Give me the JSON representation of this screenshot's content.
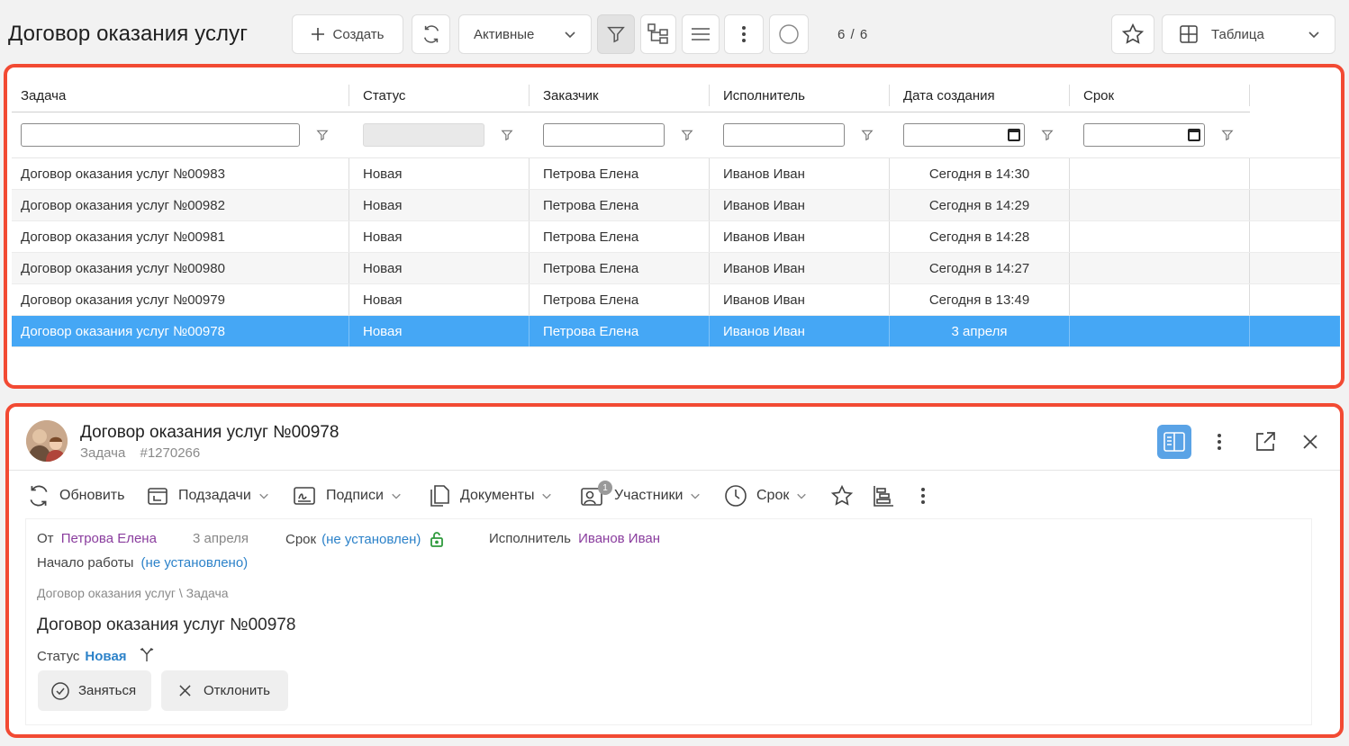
{
  "toolbar": {
    "title": "Договор оказания услуг",
    "create_label": "Создать",
    "filter_select": "Активные",
    "counter": "6 / 6",
    "view_select": "Таблица"
  },
  "grid": {
    "columns": [
      "Задача",
      "Статус",
      "Заказчик",
      "Исполнитель",
      "Дата создания",
      "Срок"
    ],
    "rows": [
      {
        "task": "Договор оказания услуг №00983",
        "status": "Новая",
        "customer": "Петрова Елена",
        "executor": "Иванов Иван",
        "created": "Сегодня в 14:30",
        "deadline": ""
      },
      {
        "task": "Договор оказания услуг №00982",
        "status": "Новая",
        "customer": "Петрова Елена",
        "executor": "Иванов Иван",
        "created": "Сегодня в 14:29",
        "deadline": ""
      },
      {
        "task": "Договор оказания услуг №00981",
        "status": "Новая",
        "customer": "Петрова Елена",
        "executor": "Иванов Иван",
        "created": "Сегодня в 14:28",
        "deadline": ""
      },
      {
        "task": "Договор оказания услуг №00980",
        "status": "Новая",
        "customer": "Петрова Елена",
        "executor": "Иванов Иван",
        "created": "Сегодня в 14:27",
        "deadline": ""
      },
      {
        "task": "Договор оказания услуг №00979",
        "status": "Новая",
        "customer": "Петрова Елена",
        "executor": "Иванов Иван",
        "created": "Сегодня в 13:49",
        "deadline": ""
      },
      {
        "task": "Договор оказания услуг №00978",
        "status": "Новая",
        "customer": "Петрова Елена",
        "executor": "Иванов Иван",
        "created": "3 апреля",
        "deadline": ""
      }
    ],
    "selected_index": 5
  },
  "detail": {
    "title": "Договор оказания услуг №00978",
    "type": "Задача",
    "id": "#1270266",
    "actions": {
      "refresh": "Обновить",
      "subtasks": "Подзадачи",
      "signatures": "Подписи",
      "documents": "Документы",
      "participants": "Участники",
      "participants_count": "1",
      "deadline": "Срок"
    },
    "meta": {
      "from_label": "От",
      "from_value": "Петрова Елена",
      "date": "3 апреля",
      "deadline_label": "Срок",
      "deadline_value": "(не установлен)",
      "executor_label": "Исполнитель",
      "executor_value": "Иванов Иван",
      "start_label": "Начало работы",
      "start_value": "(не установлено)"
    },
    "breadcrumb": "Договор оказания услуг \\ Задача",
    "card_title": "Договор оказания услуг №00978",
    "status_label": "Статус",
    "status_value": "Новая",
    "take_label": "Заняться",
    "reject_label": "Отклонить"
  },
  "colors": {
    "accent_frame": "#f24a33",
    "selected_row": "#45a7f5",
    "link_purple": "#8a3d9e",
    "link_blue": "#2c82c9",
    "lock_green": "#2e9a3c"
  }
}
